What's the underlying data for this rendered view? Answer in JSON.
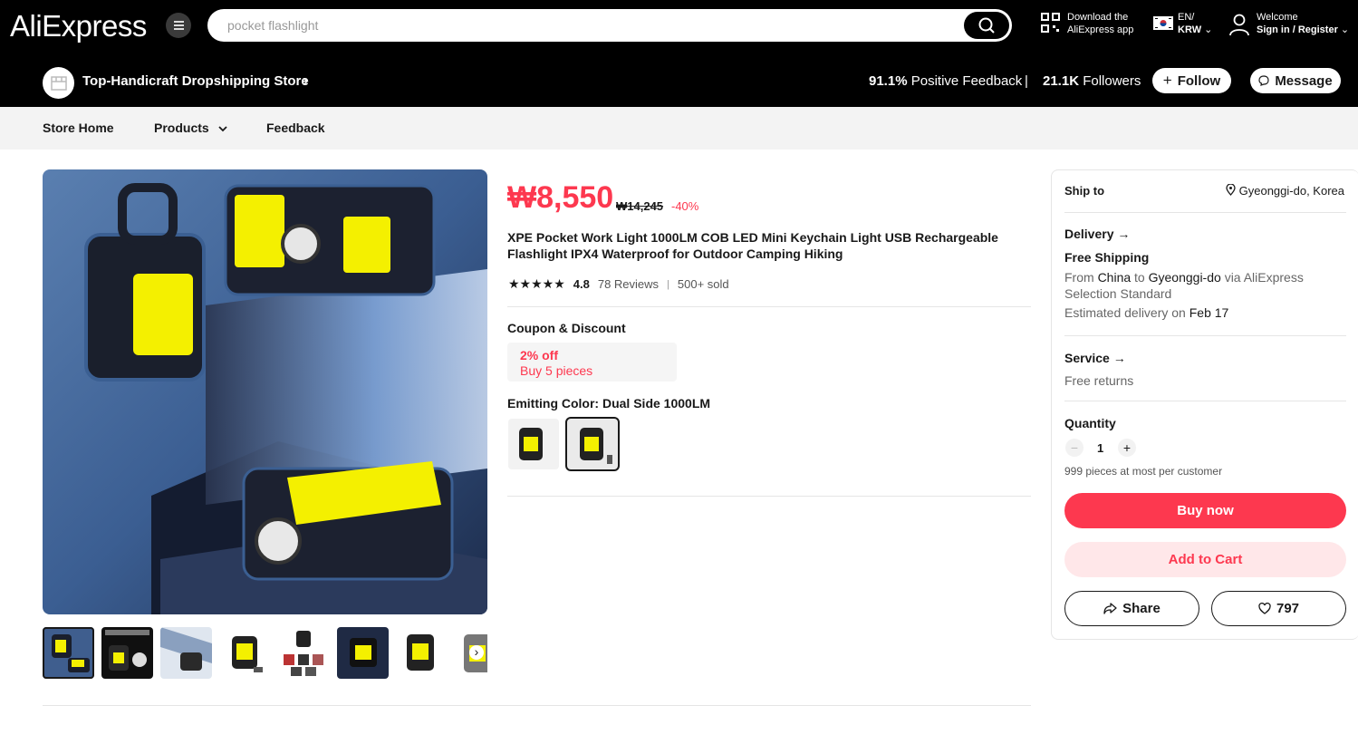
{
  "header": {
    "logo": "AliExpress",
    "search_value": "pocket flashlight",
    "app_line1": "Download the",
    "app_line2": "AliExpress app",
    "lang_line1": "EN/",
    "lang_line2": "KRW",
    "account_line1": "Welcome",
    "account_line2": "Sign in / Register"
  },
  "store": {
    "name": "Top-Handicraft Dropshipping Store",
    "feedback_value": "91.1%",
    "feedback_label": "Positive Feedback",
    "separator": "|",
    "followers_value": "21.1K",
    "followers_label": "Followers",
    "follow_label": "Follow",
    "message_label": "Message"
  },
  "nav": {
    "home": "Store Home",
    "products": "Products",
    "feedback": "Feedback"
  },
  "product": {
    "price": "₩8,550",
    "original_price": "₩14,245",
    "discount": "-40%",
    "title": "XPE Pocket Work Light 1000LM COB LED Mini Keychain Light USB Rechargeable Flashlight IPX4 Waterproof for Outdoor Camping Hiking",
    "stars": "★★★★★",
    "rating": "4.8",
    "reviews": "78 Reviews",
    "rating_sep": "|",
    "sold": "500+ sold",
    "coupon_heading": "Coupon & Discount",
    "coupon_title": "2% off",
    "coupon_condition": "Buy 5 pieces",
    "color_heading": "Emitting Color: Dual Side 1000LM"
  },
  "panel": {
    "ship_to_label": "Ship to",
    "ship_to_value": "Gyeonggi-do, Korea",
    "delivery_label": "Delivery",
    "free_shipping": "Free Shipping",
    "from_word": "From",
    "origin": "China",
    "to_word": "to",
    "destination": "Gyeonggi-do",
    "via_text": "via AliExpress",
    "via_line2": "Selection Standard",
    "estimated_text": "Estimated delivery on",
    "estimated_date": "Feb 17",
    "service_label": "Service",
    "service_value": "Free returns",
    "quantity_label": "Quantity",
    "quantity_value": "1",
    "quantity_note": "999 pieces at most per customer",
    "buy_now": "Buy now",
    "add_to_cart": "Add to Cart",
    "share": "Share",
    "wishlist_count": "797"
  },
  "colors": {
    "brand_red": "#fd384f",
    "header_bg": "#000000",
    "nav_bg": "#f3f3f3"
  }
}
